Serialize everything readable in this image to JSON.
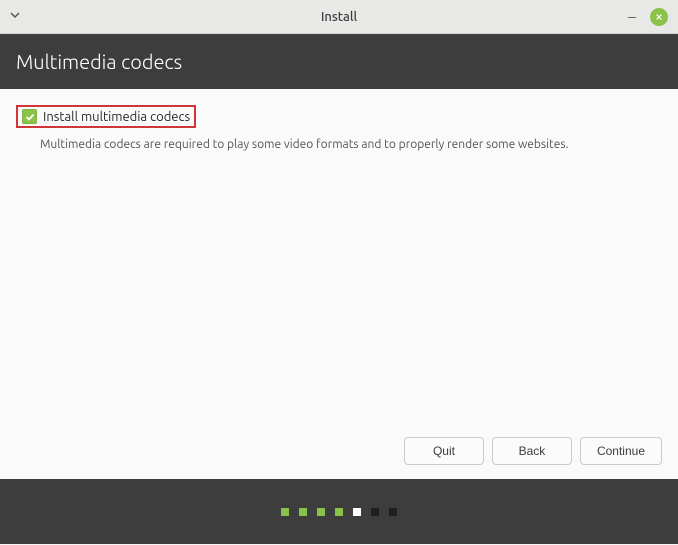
{
  "window": {
    "title": "Install"
  },
  "page": {
    "heading": "Multimedia codecs",
    "checkbox_label": "Install multimedia codecs",
    "checkbox_checked": true,
    "description": "Multimedia codecs are required to play some video formats and to properly render some websites."
  },
  "buttons": {
    "quit": "Quit",
    "back": "Back",
    "continue": "Continue"
  },
  "progress": {
    "total_steps": 7,
    "completed_steps": 4,
    "current_step": 5
  },
  "colors": {
    "accent": "#8bc34a",
    "header_bg": "#3d3d3d",
    "highlight_border": "#d13636"
  }
}
